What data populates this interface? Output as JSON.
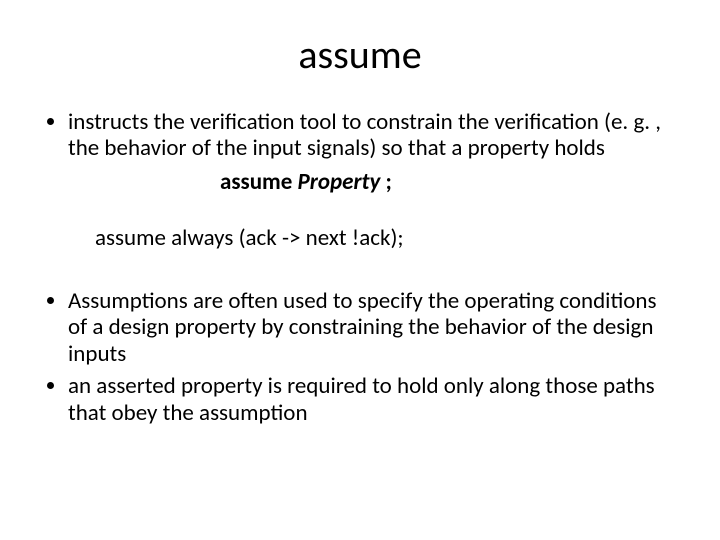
{
  "title": "assume",
  "bullet1": "instructs the verification tool to constrain the verification (e. g. , the behavior of the input signals) so that a property holds",
  "syntax_kw": "assume",
  "syntax_prop": "Property",
  "syntax_tail": " ;",
  "example": "assume always (ack -> next !ack);",
  "bullet2": "Assumptions are often used to specify the operating conditions of a design property by constraining the behavior of the design inputs",
  "bullet3": "an asserted property is required to hold only along those paths that obey the assumption"
}
